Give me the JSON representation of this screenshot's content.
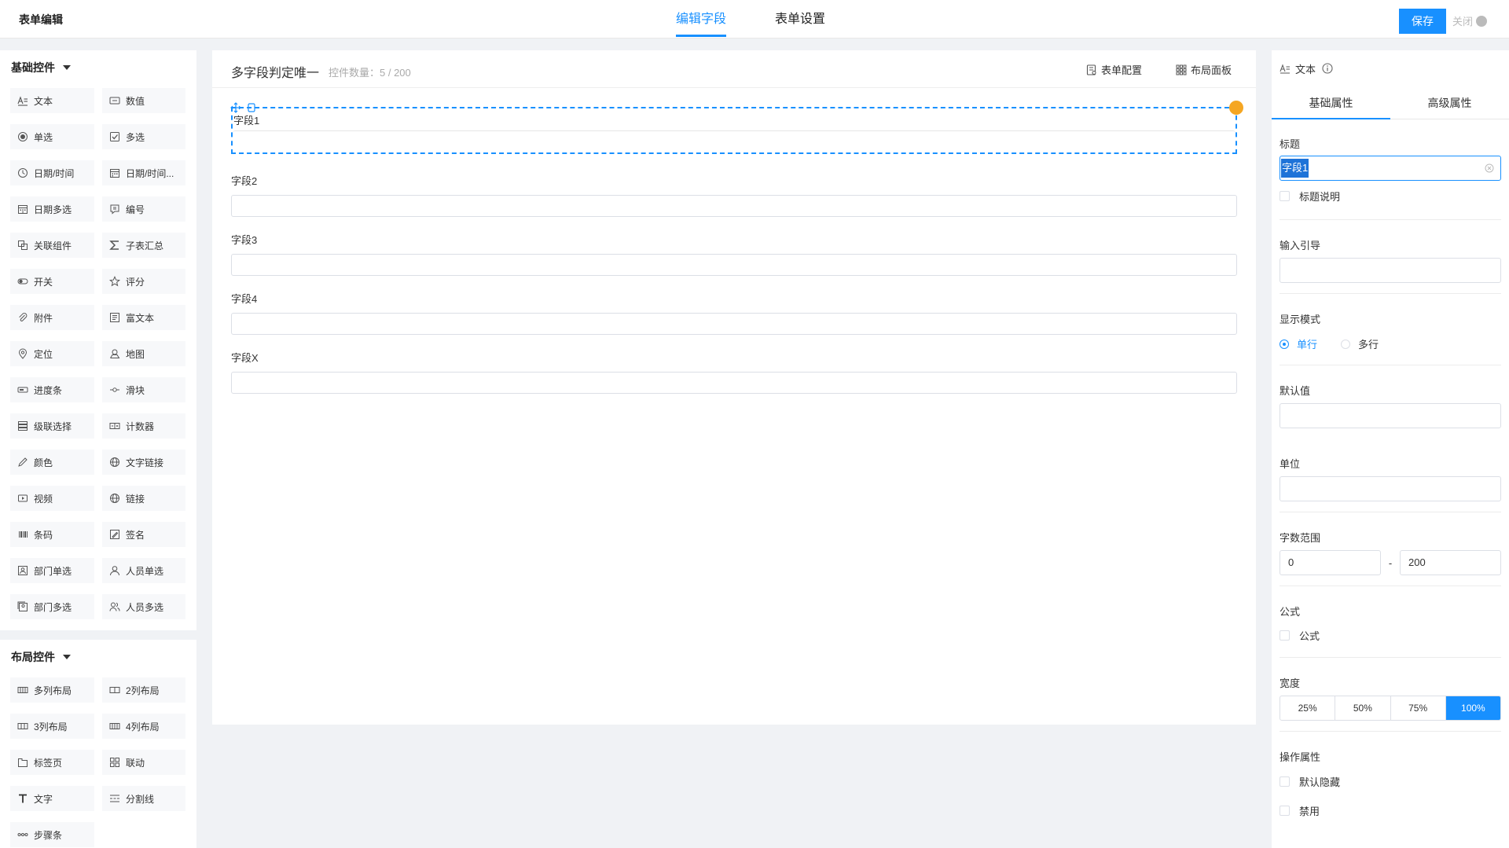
{
  "header": {
    "title": "表单编辑",
    "tabs": [
      {
        "label": "编辑字段",
        "active": true
      },
      {
        "label": "表单设置",
        "active": false
      }
    ],
    "save_label": "保存",
    "close_label": "关闭"
  },
  "left": {
    "basic_title": "基础控件",
    "basic_items": [
      {
        "label": "文本",
        "icon": "text-icon"
      },
      {
        "label": "数值",
        "icon": "number-icon"
      },
      {
        "label": "单选",
        "icon": "radio-icon"
      },
      {
        "label": "多选",
        "icon": "checkbox-icon"
      },
      {
        "label": "日期/时间",
        "icon": "clock-icon"
      },
      {
        "label": "日期/时间...",
        "icon": "calendar-icon"
      },
      {
        "label": "日期多选",
        "icon": "calendar-multi-icon"
      },
      {
        "label": "编号",
        "icon": "serial-icon"
      },
      {
        "label": "关联组件",
        "icon": "link-component-icon"
      },
      {
        "label": "子表汇总",
        "icon": "sigma-icon"
      },
      {
        "label": "开关",
        "icon": "toggle-icon"
      },
      {
        "label": "评分",
        "icon": "star-icon"
      },
      {
        "label": "附件",
        "icon": "paperclip-icon"
      },
      {
        "label": "富文本",
        "icon": "richtext-icon"
      },
      {
        "label": "定位",
        "icon": "location-icon"
      },
      {
        "label": "地图",
        "icon": "map-icon"
      },
      {
        "label": "进度条",
        "icon": "progress-icon"
      },
      {
        "label": "滑块",
        "icon": "slider-icon"
      },
      {
        "label": "级联选择",
        "icon": "cascade-icon"
      },
      {
        "label": "计数器",
        "icon": "counter-icon"
      },
      {
        "label": "颜色",
        "icon": "pen-icon"
      },
      {
        "label": "文字链接",
        "icon": "globe-icon"
      },
      {
        "label": "视频",
        "icon": "video-icon"
      },
      {
        "label": "链接",
        "icon": "globe-icon"
      },
      {
        "label": "条码",
        "icon": "barcode-icon"
      },
      {
        "label": "签名",
        "icon": "signature-icon"
      },
      {
        "label": "部门单选",
        "icon": "department-icon"
      },
      {
        "label": "人员单选",
        "icon": "user-icon"
      },
      {
        "label": "部门多选",
        "icon": "department-multi-icon"
      },
      {
        "label": "人员多选",
        "icon": "users-icon"
      }
    ],
    "layout_title": "布局控件",
    "layout_items": [
      {
        "label": "多列布局",
        "icon": "columns-icon"
      },
      {
        "label": "2列布局",
        "icon": "columns-2-icon"
      },
      {
        "label": "3列布局",
        "icon": "columns-3-icon"
      },
      {
        "label": "4列布局",
        "icon": "columns-4-icon"
      },
      {
        "label": "标签页",
        "icon": "tabs-icon"
      },
      {
        "label": "联动",
        "icon": "grid-icon"
      },
      {
        "label": "文字",
        "icon": "text-t-icon"
      },
      {
        "label": "分割线",
        "icon": "divider-icon"
      },
      {
        "label": "步骤条",
        "icon": "steps-icon"
      }
    ]
  },
  "canvas": {
    "form_name": "多字段判定唯一",
    "control_count": "控件数量：5 / 200",
    "config_label": "表单配置",
    "layout_panel_label": "布局面板",
    "fields": [
      {
        "label": "字段1",
        "selected": true
      },
      {
        "label": "字段2",
        "selected": false
      },
      {
        "label": "字段3",
        "selected": false
      },
      {
        "label": "字段4",
        "selected": false
      },
      {
        "label": "字段X",
        "selected": false
      }
    ]
  },
  "right": {
    "type_label": "文本",
    "tabs": [
      {
        "label": "基础属性",
        "active": true
      },
      {
        "label": "高级属性",
        "active": false
      }
    ],
    "title_label": "标题",
    "title_value": "字段1",
    "title_desc_label": "标题说明",
    "placeholder_label": "输入引导",
    "display_mode_label": "显示模式",
    "display_modes": [
      "单行",
      "多行"
    ],
    "default_label": "默认值",
    "unit_label": "单位",
    "length_label": "字数范围",
    "length_min": "0",
    "length_sep": "-",
    "length_max": "200",
    "formula_label": "公式",
    "formula_check_label": "公式",
    "width_label": "宽度",
    "width_options": [
      "25%",
      "50%",
      "75%",
      "100%"
    ],
    "width_selected": "100%",
    "ops_label": "操作属性",
    "hidden_label": "默认隐藏",
    "disabled_label": "禁用"
  },
  "colors": {
    "accent": "#1890ff",
    "delete_badge": "#f5a623"
  }
}
